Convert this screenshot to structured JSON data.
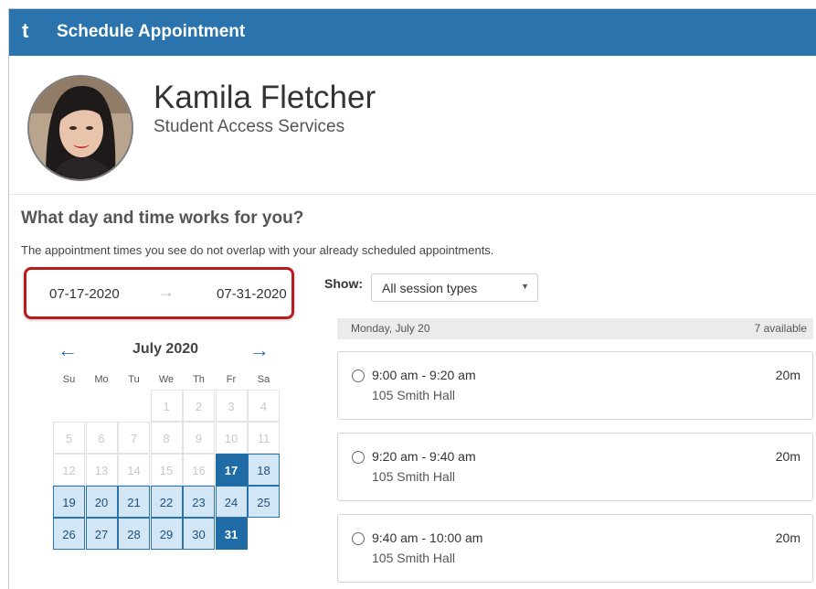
{
  "header": {
    "title": "Schedule Appointment",
    "logo_glyph": "t"
  },
  "profile": {
    "name": "Kamila Fletcher",
    "department": "Student Access Services"
  },
  "prompt": {
    "question": "What day and time works for you?",
    "note": "The appointment times you see do not overlap with your already scheduled appointments."
  },
  "range": {
    "start": "07-17-2020",
    "arrow": "→",
    "end": "07-31-2020"
  },
  "calendar": {
    "month": "July 2020",
    "prev": "←",
    "next": "→",
    "weekdays": [
      "Su",
      "Mo",
      "Tu",
      "We",
      "Th",
      "Fr",
      "Sa"
    ],
    "days": [
      {
        "d": "1",
        "s": "off"
      },
      {
        "d": "2",
        "s": "off"
      },
      {
        "d": "3",
        "s": "off"
      },
      {
        "d": "4",
        "s": "off"
      },
      {
        "d": "5",
        "s": "off"
      },
      {
        "d": "6",
        "s": "off"
      },
      {
        "d": "7",
        "s": "off"
      },
      {
        "d": "8",
        "s": "off"
      },
      {
        "d": "9",
        "s": "off"
      },
      {
        "d": "10",
        "s": "off"
      },
      {
        "d": "11",
        "s": "off"
      },
      {
        "d": "12",
        "s": "off"
      },
      {
        "d": "13",
        "s": "off"
      },
      {
        "d": "14",
        "s": "off"
      },
      {
        "d": "15",
        "s": "off"
      },
      {
        "d": "16",
        "s": "off"
      },
      {
        "d": "17",
        "s": "sel"
      },
      {
        "d": "18",
        "s": "avail"
      },
      {
        "d": "19",
        "s": "avail"
      },
      {
        "d": "20",
        "s": "avail"
      },
      {
        "d": "21",
        "s": "avail"
      },
      {
        "d": "22",
        "s": "avail"
      },
      {
        "d": "23",
        "s": "avail"
      },
      {
        "d": "24",
        "s": "avail"
      },
      {
        "d": "25",
        "s": "avail"
      },
      {
        "d": "26",
        "s": "avail"
      },
      {
        "d": "27",
        "s": "avail"
      },
      {
        "d": "28",
        "s": "avail"
      },
      {
        "d": "29",
        "s": "avail"
      },
      {
        "d": "30",
        "s": "avail"
      },
      {
        "d": "31",
        "s": "sel"
      }
    ],
    "first_weekday_index": 3
  },
  "filter": {
    "label": "Show:",
    "value": "All session types",
    "caret": "▼"
  },
  "day_group": {
    "label": "Monday, July 20",
    "count": "7 available"
  },
  "slots": [
    {
      "time": "9:00 am - 9:20 am",
      "location": "105 Smith Hall",
      "duration": "20m"
    },
    {
      "time": "9:20 am - 9:40 am",
      "location": "105 Smith Hall",
      "duration": "20m"
    },
    {
      "time": "9:40 am - 10:00 am",
      "location": "105 Smith Hall",
      "duration": "20m"
    }
  ],
  "colors": {
    "brand": "#2a73ad",
    "highlight": "#b91c1c",
    "selected": "#1f6ba5",
    "available": "#d3e6f5"
  },
  "icons": {
    "logo": "brand-logo-icon",
    "prev": "arrow-left-icon",
    "next": "arrow-right-icon",
    "range": "arrow-right-icon",
    "caret": "caret-down-icon",
    "radio": "radio-icon"
  }
}
